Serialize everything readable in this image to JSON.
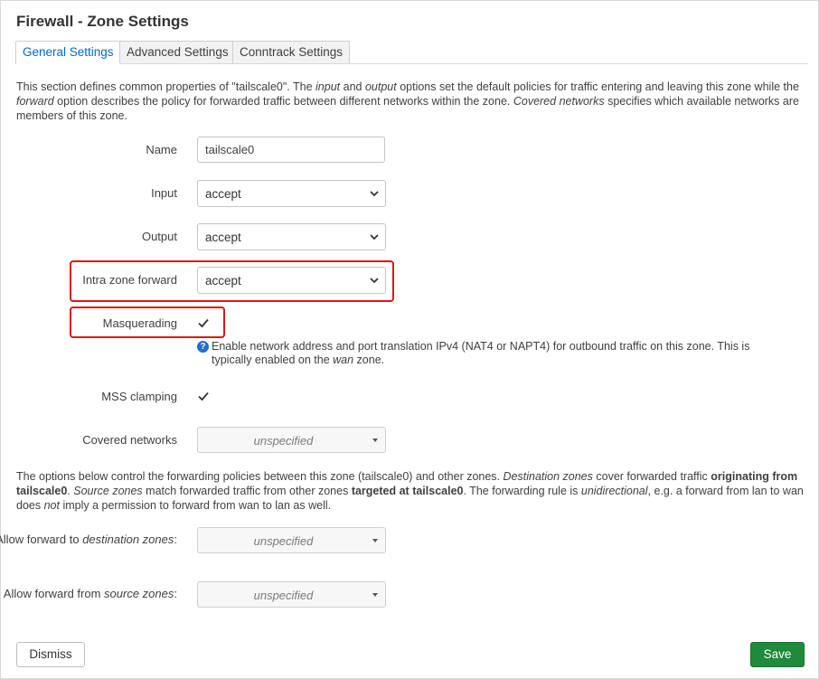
{
  "title": "Firewall - Zone Settings",
  "tabs": [
    {
      "label": "General Settings"
    },
    {
      "label": "Advanced Settings"
    },
    {
      "label": "Conntrack Settings"
    }
  ],
  "intro": {
    "t1": "This section defines common properties of \"tailscale0\". The ",
    "i1": "input",
    "t2": " and ",
    "i2": "output",
    "t3": " options set the default policies for traffic entering and leaving this zone while the ",
    "i3": "forward",
    "t4": " option describes the policy for forwarded traffic between different networks within the zone. ",
    "i4": "Covered networks",
    "t5": " specifies which available networks are members of this zone."
  },
  "fields": {
    "name": {
      "label": "Name",
      "value": "tailscale0"
    },
    "input": {
      "label": "Input",
      "value": "accept"
    },
    "output": {
      "label": "Output",
      "value": "accept"
    },
    "intra_zone": {
      "label": "Intra zone forward",
      "value": "accept"
    },
    "masquerading": {
      "label": "Masquerading",
      "checked": true,
      "help": {
        "t1": "Enable network address and port translation IPv4 (NAT4 or NAPT4) for outbound traffic on this zone. This is typically enabled on the ",
        "i1": "wan",
        "t2": " zone."
      }
    },
    "mss_clamping": {
      "label": "MSS clamping",
      "checked": true
    },
    "covered_networks": {
      "label": "Covered networks",
      "value": "unspecified"
    }
  },
  "forwarding_text": {
    "t1": "The options below control the forwarding policies between this zone (tailscale0) and other zones. ",
    "i1": "Destination zones",
    "t2": " cover forwarded traffic ",
    "b1": "originating from tailscale0",
    "t3": ". ",
    "i2": "Source zones",
    "t4": " match forwarded traffic from other zones ",
    "b2": "targeted at tailscale0",
    "t5": ". The forwarding rule is ",
    "i3": "unidirectional",
    "t6": ", e.g. a forward from lan to wan does ",
    "i4": "not",
    "t7": " imply a permission to forward from wan to lan as well."
  },
  "forward_to": {
    "label_pre": "Allow forward to ",
    "label_em": "destination zones",
    "label_post": ":",
    "value": "unspecified"
  },
  "forward_from": {
    "label_pre": "Allow forward from ",
    "label_em": "source zones",
    "label_post": ":",
    "value": "unspecified"
  },
  "buttons": {
    "dismiss": "Dismiss",
    "save": "Save"
  },
  "icons": {
    "help": "question-circle-icon",
    "select": "chevron-down-icon",
    "dropdown": "caret-down-icon",
    "checkbox": "checkmark-icon"
  },
  "colors": {
    "accent": "#0069d6",
    "save": "#1e8a3b",
    "highlight": "#e0151c"
  }
}
